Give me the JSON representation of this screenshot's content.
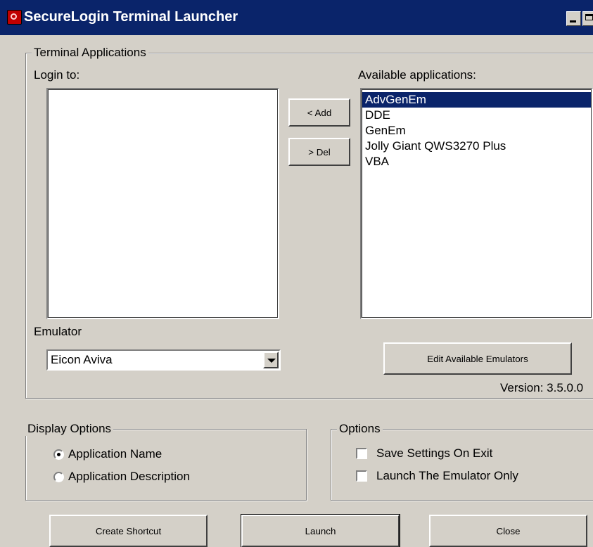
{
  "window": {
    "title": "SecureLogin Terminal Launcher"
  },
  "terminal_group": {
    "legend": "Terminal Applications",
    "login_to_label": "Login to:",
    "login_to_items": [],
    "available_label": "Available applications:",
    "available_items": [
      "AdvGenEm",
      "DDE",
      "GenEm",
      "Jolly Giant QWS3270 Plus",
      "VBA"
    ],
    "selected_available": "AdvGenEm",
    "add_button": "< Add",
    "del_button": "> Del",
    "emulator_label": "Emulator",
    "emulator_value": "Eicon Aviva",
    "edit_emulators_button": "Edit Available Emulators",
    "version_text": "Version: 3.5.0.0"
  },
  "display_options": {
    "legend": "Display Options",
    "radio_name": "Application Name",
    "radio_desc": "Application Description",
    "selected": "Application Name"
  },
  "options": {
    "legend": "Options",
    "save_settings": "Save Settings On Exit",
    "save_settings_checked": false,
    "launch_only": "Launch The Emulator Only",
    "launch_only_checked": false
  },
  "buttons": {
    "create_shortcut": "Create Shortcut",
    "launch": "Launch",
    "close": "Close"
  }
}
